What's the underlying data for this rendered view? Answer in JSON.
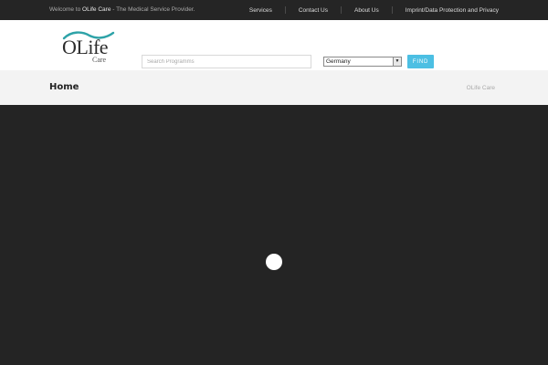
{
  "topbar": {
    "welcome_prefix": "Welcome to ",
    "welcome_brand": "OLife Care",
    "welcome_suffix": " - The Medical Service Provider.",
    "nav": [
      "Services",
      "Contact Us",
      "About Us",
      "Imprint/Data Protection and Privacy"
    ]
  },
  "header": {
    "logo": {
      "name": "OLife",
      "sub": "Care",
      "accent_color": "#2ea3a8"
    },
    "search": {
      "placeholder": "Search Programms",
      "value": ""
    },
    "country": {
      "selected": "Germany",
      "icon": "dropdown-arrow-icon"
    },
    "find_label": "FIND",
    "find_color": "#4cbfe3"
  },
  "page": {
    "title": "Home",
    "breadcrumb": "OLife Care"
  },
  "loader": {
    "icon": "loading-spinner-icon"
  }
}
